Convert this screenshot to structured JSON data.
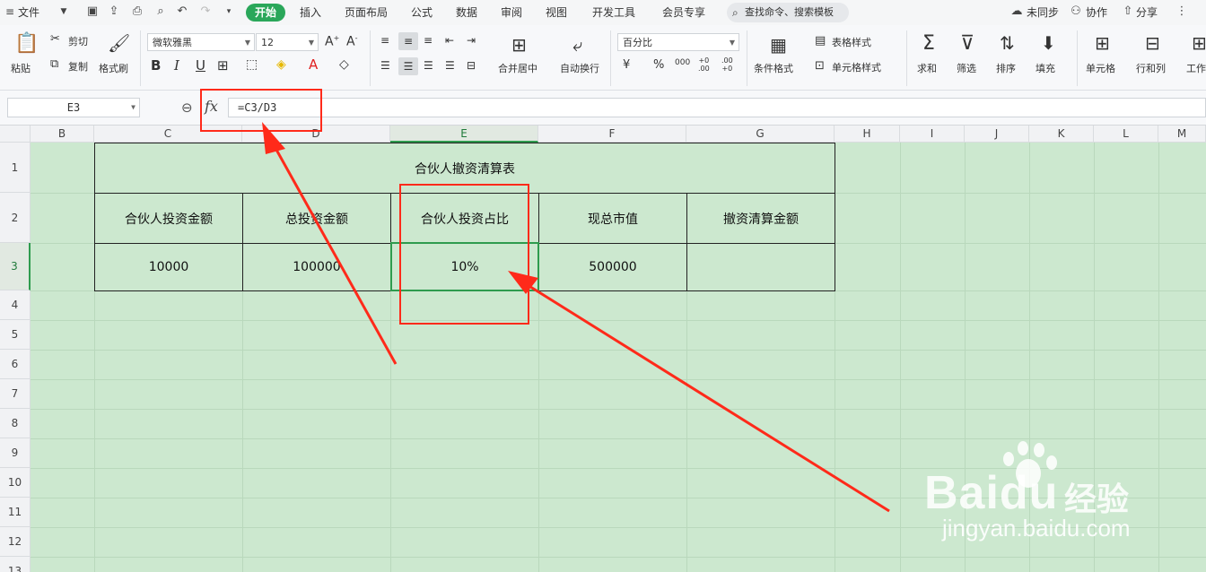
{
  "menubar": {
    "file_label": "文件",
    "tabs": [
      "开始",
      "插入",
      "页面布局",
      "公式",
      "数据",
      "审阅",
      "视图",
      "开发工具",
      "会员专享"
    ],
    "search_placeholder": "查找命令、搜索模板",
    "sync_label": "未同步",
    "collab_label": "协作",
    "share_label": "分享"
  },
  "ribbon": {
    "paste": "粘贴",
    "cut": "剪切",
    "copy": "复制",
    "format_painter": "格式刷",
    "font_name": "微软雅黑",
    "font_size": "12",
    "merge_center": "合并居中",
    "wrap_text": "自动换行",
    "number_format": "百分比",
    "cond_format": "条件格式",
    "table_style": "表格样式",
    "cell_style": "单元格样式",
    "sum": "求和",
    "filter": "筛选",
    "sort": "排序",
    "fill": "填充",
    "cell": "单元格",
    "row_col": "行和列",
    "worksheet": "工作"
  },
  "formula_bar": {
    "name_box": "E3",
    "fx_label": "fx",
    "formula": "=C3/D3"
  },
  "sheet": {
    "columns": [
      "B",
      "C",
      "D",
      "E",
      "F",
      "G",
      "H",
      "I",
      "J",
      "K",
      "L",
      "M"
    ],
    "rows": [
      "1",
      "2",
      "3",
      "4",
      "5",
      "6",
      "7",
      "8",
      "9",
      "10",
      "11",
      "12",
      "13"
    ],
    "selected_cell": "E3"
  },
  "table": {
    "title": "合伙人撤资清算表",
    "headers": [
      "合伙人投资金额",
      "总投资金额",
      "合伙人投资占比",
      "现总市值",
      "撤资清算金额"
    ],
    "values": [
      "10000",
      "100000",
      "10%",
      "500000",
      ""
    ]
  },
  "watermark": {
    "brand": "Baidu",
    "cn": "经验",
    "url": "jingyan.baidu.com"
  },
  "colors": {
    "accent_green": "#2aa75a",
    "sheet_bg": "#cce8cf",
    "annotation_red": "#ff2a1a"
  }
}
